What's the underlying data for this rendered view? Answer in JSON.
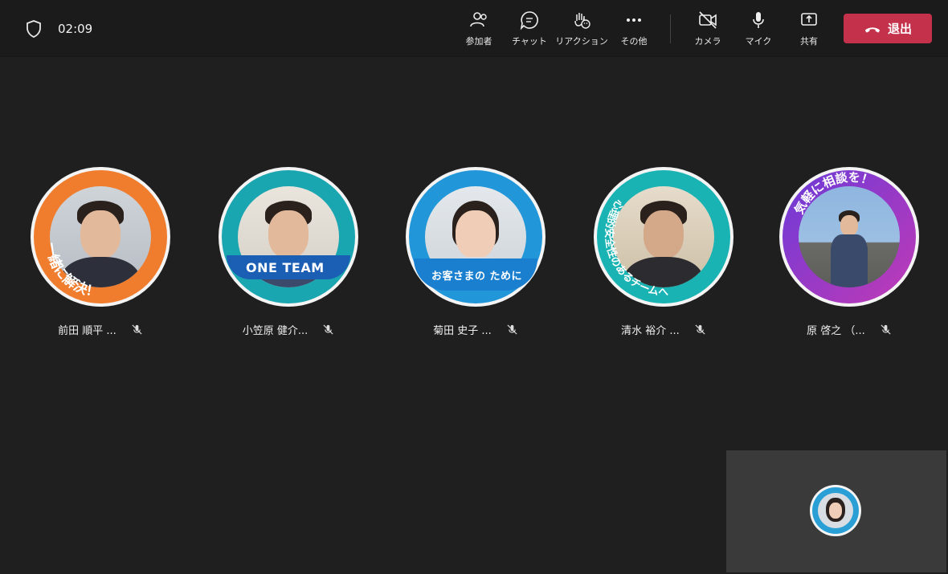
{
  "topbar": {
    "timer": "02:09",
    "buttons": {
      "participants": "参加者",
      "chat": "チャット",
      "reactions": "リアクション",
      "more": "その他",
      "camera": "カメラ",
      "mic": "マイク",
      "share": "共有"
    },
    "leave_label": "退出",
    "leave_color": "#c4314b"
  },
  "participants": [
    {
      "name": "前田 順平 ...",
      "ring_color": "#f07c2e",
      "banner": "一緒に解決！"
    },
    {
      "name": "小笠原 健介...",
      "ring_color": "#1aa6b0",
      "banner": "ONE TEAM"
    },
    {
      "name": "菊田 史子 ...",
      "ring_color": "#2196d8",
      "banner": "お客さまの ために"
    },
    {
      "name": "清水 裕介 ...",
      "ring_color": "#1ab3b3",
      "banner": "心理的安全性のあるチームへ"
    },
    {
      "name": "原 啓之 （...",
      "ring_color": "#9a3fd0",
      "banner": "気軽に相談を！"
    }
  ]
}
